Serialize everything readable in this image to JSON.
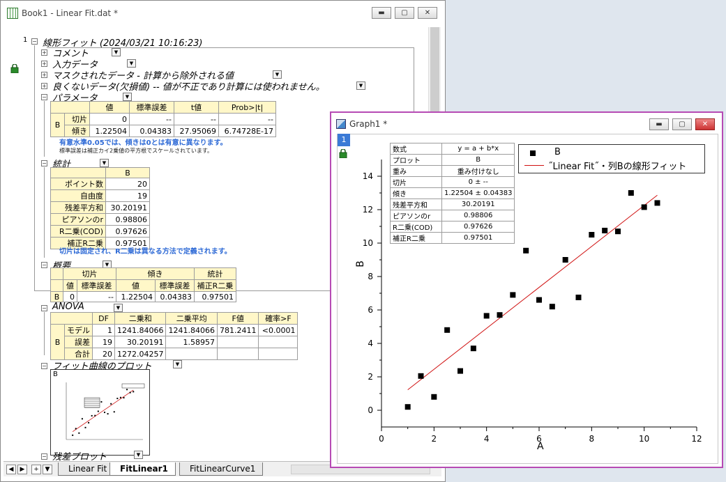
{
  "workbook_window": {
    "title": "Book1 - Linear Fit.dat *",
    "row_number": "1",
    "report_title": "線形フィット (2024/03/21 10:16:23)",
    "sections": {
      "comment": "コメント",
      "input_data": "入力データ",
      "masked_data": "マスクされたデータ - 計算から除外される値",
      "bad_data": "良くないデータ(欠損値) -- 値が不正であり計算には使われません。",
      "parameters": "パラメータ",
      "statistics": "統計",
      "summary": "概要",
      "anova": "ANOVA",
      "fit_curve_plot": "フィット曲線のプロット",
      "residual_plot": "残差プロット"
    },
    "parameters_table": {
      "headers": [
        "値",
        "標準誤差",
        "t値",
        "Prob>|t|"
      ],
      "group": "B",
      "rows": [
        {
          "label": "切片",
          "values": [
            "0",
            "--",
            "--",
            "--"
          ]
        },
        {
          "label": "傾き",
          "values": [
            "1.22504",
            "0.04383",
            "27.95069",
            "6.74728E-17"
          ]
        }
      ],
      "note1": "有意水準0.05では、傾きは0とは有意に異なります。",
      "note2": "標準誤差は補正カイ2乗値の平方根でスケールされています。"
    },
    "statistics_table": {
      "header": "B",
      "rows": [
        {
          "label": "ポイント数",
          "value": "20"
        },
        {
          "label": "自由度",
          "value": "19"
        },
        {
          "label": "残差平方和",
          "value": "30.20191"
        },
        {
          "label": "ピアソンのr",
          "value": "0.98806"
        },
        {
          "label": "R二乗(COD)",
          "value": "0.97626"
        },
        {
          "label": "補正R二乗",
          "value": "0.97501"
        }
      ],
      "note": "切片は固定され、R二乗は異なる方法で定義されます。"
    },
    "summary_table": {
      "groups": [
        "切片",
        "傾き",
        "統計"
      ],
      "subheaders": [
        "値",
        "標準誤差",
        "値",
        "標準誤差",
        "補正R二乗"
      ],
      "row_label": "B",
      "values": [
        "0",
        "--",
        "1.22504",
        "0.04383",
        "0.97501"
      ]
    },
    "anova_table": {
      "headers": [
        "DF",
        "二乗和",
        "二乗平均",
        "F値",
        "確率>F"
      ],
      "group": "B",
      "rows": [
        {
          "label": "モデル",
          "values": [
            "1",
            "1241.84066",
            "1241.84066",
            "781.2411",
            "<0.0001"
          ]
        },
        {
          "label": "誤差",
          "values": [
            "19",
            "30.20191",
            "1.58957",
            "",
            ""
          ]
        },
        {
          "label": "合計",
          "values": [
            "20",
            "1272.04257",
            "",
            "",
            ""
          ]
        }
      ]
    },
    "fit_plot_thumb_label": "B",
    "sheet_tabs": [
      "Linear Fit",
      "FitLinear1",
      "FitLinearCurve1"
    ],
    "active_tab": "FitLinear1",
    "nav_buttons": [
      "◀",
      "▶",
      "+",
      "▼"
    ]
  },
  "graph_window": {
    "title": "Graph1 *",
    "layer_number": "1",
    "info_table": [
      {
        "label": "数式",
        "value": "y = a + b*x"
      },
      {
        "label": "プロット",
        "value": "B"
      },
      {
        "label": "重み",
        "value": "重み付けなし"
      },
      {
        "label": "切片",
        "value": "0 ± --"
      },
      {
        "label": "傾き",
        "value": "1.22504 ± 0.04383"
      },
      {
        "label": "残差平方和",
        "value": "30.20191"
      },
      {
        "label": "ピアソンのr",
        "value": "0.98806"
      },
      {
        "label": "R二乗(COD)",
        "value": "0.97626"
      },
      {
        "label": "補正R二乗",
        "value": "0.97501"
      }
    ],
    "legend": [
      {
        "name": "B",
        "symbol": "square"
      },
      {
        "name": "˝Linear Fit˝・列Bの線形フィット",
        "symbol": "line"
      }
    ]
  },
  "chart_data": {
    "type": "scatter",
    "xlabel": "A",
    "ylabel": "B",
    "xlim": [
      0,
      12
    ],
    "ylim": [
      -1,
      15
    ],
    "x_ticks": [
      0,
      2,
      4,
      6,
      8,
      10,
      12
    ],
    "y_ticks": [
      0,
      2,
      4,
      6,
      8,
      10,
      12,
      14
    ],
    "points": {
      "x": [
        1,
        1.5,
        2,
        2.5,
        3,
        3.5,
        4,
        4.5,
        5,
        5.5,
        6,
        6.5,
        7,
        7.5,
        8,
        8.5,
        9,
        9.5,
        10,
        10.5
      ],
      "y": [
        0.2,
        2.05,
        0.8,
        4.8,
        2.35,
        3.7,
        5.65,
        5.7,
        6.9,
        9.55,
        6.6,
        6.2,
        9,
        6.75,
        10.5,
        10.75,
        10.7,
        13,
        12.15,
        12.4
      ]
    },
    "fit_line": {
      "slope": 1.22504,
      "intercept": 0,
      "x_range": [
        1,
        10.5
      ]
    },
    "colors": {
      "points": "#000000",
      "fit": "#d01010"
    },
    "grid": false,
    "legend_position": "top-right"
  }
}
